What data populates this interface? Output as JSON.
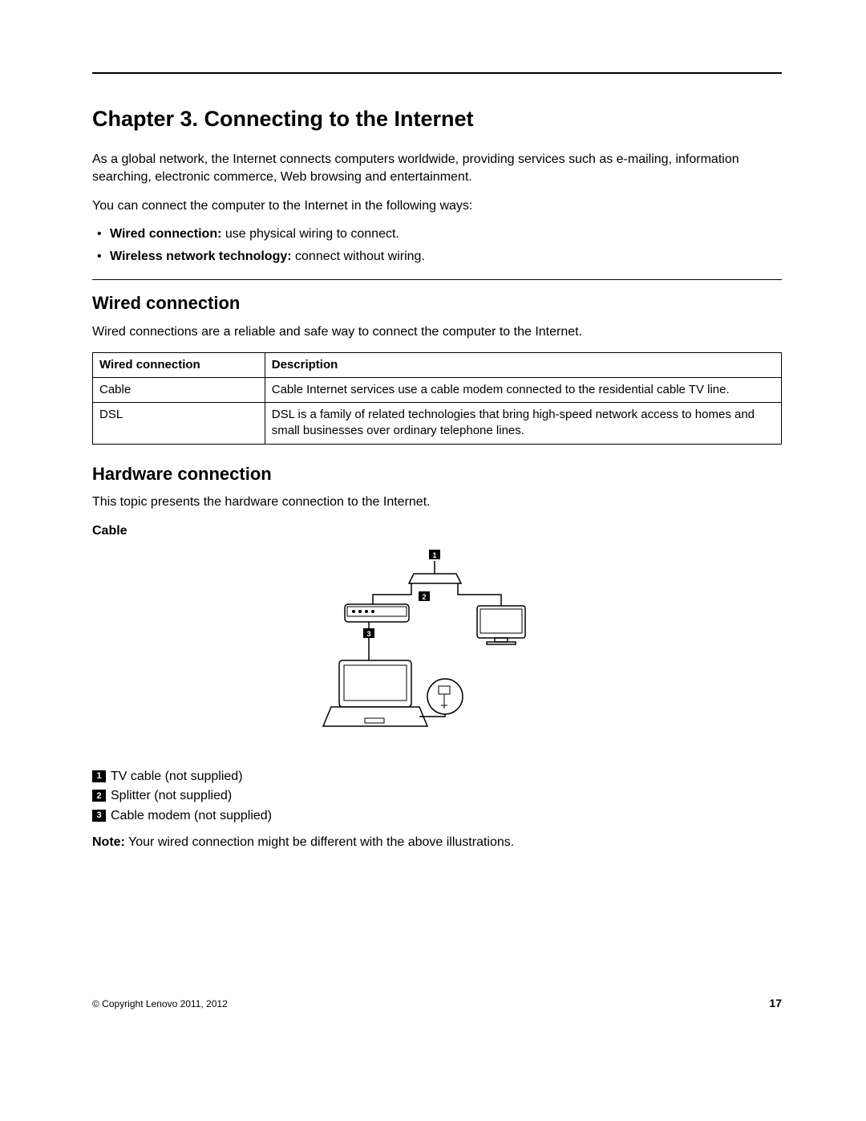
{
  "chapter": {
    "title": "Chapter 3.   Connecting to the Internet",
    "intro1": "As a global network, the Internet connects computers worldwide, providing services such as e-mailing, information searching, electronic commerce, Web browsing and entertainment.",
    "intro2": "You can connect the computer to the Internet in the following ways:",
    "bullets": [
      {
        "bold": "Wired connection:",
        "rest": " use physical wiring to connect."
      },
      {
        "bold": "Wireless network technology:",
        "rest": " connect without wiring."
      }
    ]
  },
  "wired": {
    "heading": "Wired connection",
    "intro": "Wired connections are a reliable and safe way to connect the computer to the Internet.",
    "table": {
      "headers": [
        "Wired connection",
        "Description"
      ],
      "rows": [
        [
          "Cable",
          "Cable Internet services use a cable modem connected to the residential cable TV line."
        ],
        [
          "DSL",
          "DSL is a family of related technologies that bring high-speed network access to homes and small businesses over ordinary telephone lines."
        ]
      ]
    }
  },
  "hardware": {
    "heading": "Hardware connection",
    "intro": "This topic presents the hardware connection to the Internet.",
    "subhead": "Cable",
    "legend": [
      {
        "num": "1",
        "text": "TV cable (not supplied)"
      },
      {
        "num": "2",
        "text": "Splitter (not supplied)"
      },
      {
        "num": "3",
        "text": "Cable modem (not supplied)"
      }
    ],
    "note_label": "Note:",
    "note_text": " Your wired connection might be different with the above illustrations."
  },
  "footer": {
    "copyright": "© Copyright Lenovo 2011, 2012",
    "page": "17"
  },
  "callouts": {
    "c1": "1",
    "c2": "2",
    "c3": "3"
  }
}
